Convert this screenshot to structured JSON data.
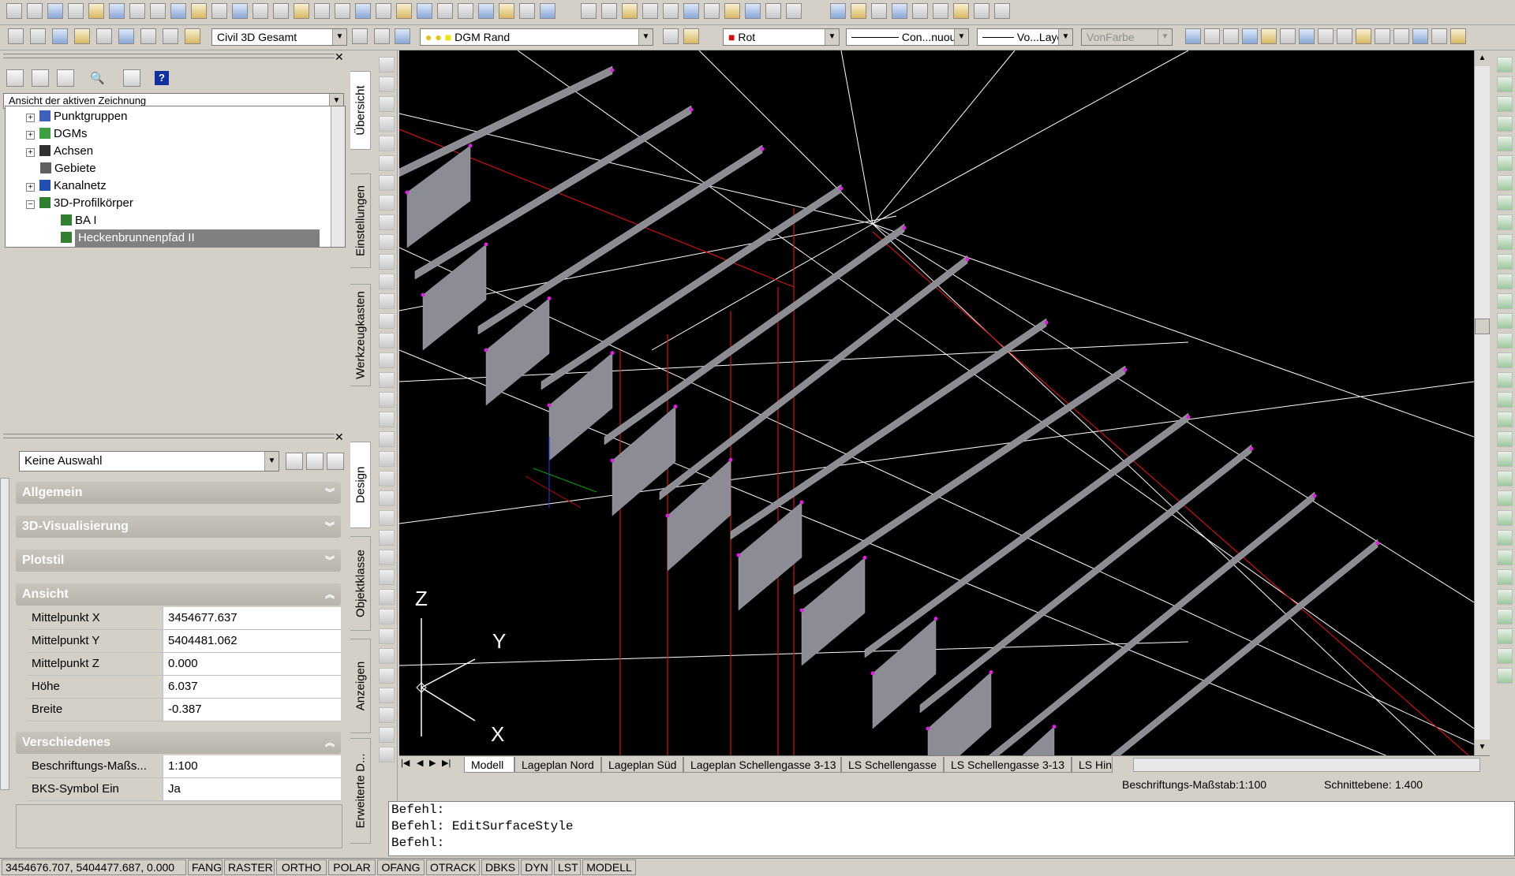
{
  "toolbar2": {
    "workspace": "Civil 3D Gesamt",
    "layer": "DGM Rand",
    "color": "Rot",
    "linetype": "Con...nuous",
    "lineweight": "Vo...Layer",
    "plotstyle": "VonFarbe"
  },
  "prospector": {
    "view_label": "Ansicht der aktiven Zeichnung",
    "items": [
      {
        "label": "Punktgruppen"
      },
      {
        "label": "DGMs"
      },
      {
        "label": "Achsen"
      },
      {
        "label": "Gebiete"
      },
      {
        "label": "Kanalnetz"
      },
      {
        "label": "3D-Profilkörper"
      },
      {
        "label": "BA I"
      },
      {
        "label": "Heckenbrunnenpfad II"
      }
    ],
    "side_tabs": [
      "Übersicht",
      "Einstellungen",
      "Werkzeugkasten"
    ]
  },
  "properties": {
    "selection": "Keine Auswahl",
    "sections": {
      "allgemein": "Allgemein",
      "visualisierung": "3D-Visualisierung",
      "plotstil": "Plotstil",
      "ansicht": "Ansicht",
      "verschiedenes": "Verschiedenes"
    },
    "ansicht_rows": [
      {
        "key": "Mittelpunkt X",
        "value": "3454677.637"
      },
      {
        "key": "Mittelpunkt Y",
        "value": "5404481.062"
      },
      {
        "key": "Mittelpunkt Z",
        "value": "0.000"
      },
      {
        "key": "Höhe",
        "value": "6.037"
      },
      {
        "key": "Breite",
        "value": "-0.387"
      }
    ],
    "verschiedenes_rows": [
      {
        "key": "Beschriftungs-Maßs...",
        "value": "1:100"
      },
      {
        "key": "BKS-Symbol Ein",
        "value": "Ja"
      }
    ],
    "side_tabs": [
      "Design",
      "Objektklasse",
      "Anzeigen",
      "Erweiterte D..."
    ]
  },
  "ucs": {
    "z": "Z",
    "y": "Y",
    "x": "X"
  },
  "layout_tabs": [
    "Modell",
    "Lageplan Nord",
    "Lageplan Süd",
    "Lageplan Schellengasse 3-13",
    "LS Schellengasse",
    "LS Schellengasse 3-13",
    "LS Hint"
  ],
  "view_status": {
    "scale_label": "Beschriftungs-Maßstab:",
    "scale_value": "1:100",
    "cut_label": "Schnittebene:",
    "cut_value": "1.400"
  },
  "command": {
    "lines": [
      "Befehl:",
      "Befehl: EditSurfaceStyle",
      "Befehl:"
    ]
  },
  "statusbar": {
    "coords": "3454676.707, 5404477.687, 0.000",
    "toggles": [
      "FANG",
      "RASTER",
      "ORTHO",
      "POLAR",
      "OFANG",
      "OTRACK",
      "DBKS",
      "DYN",
      "LST",
      "MODELL"
    ]
  },
  "colors": {
    "viewport_bg": "#000000",
    "red_lines": "#d01010",
    "wire_white": "#ffffff",
    "panel_grey": "#8c8c94",
    "vertex_magenta": "#e020e0",
    "highlight": "#808080"
  }
}
